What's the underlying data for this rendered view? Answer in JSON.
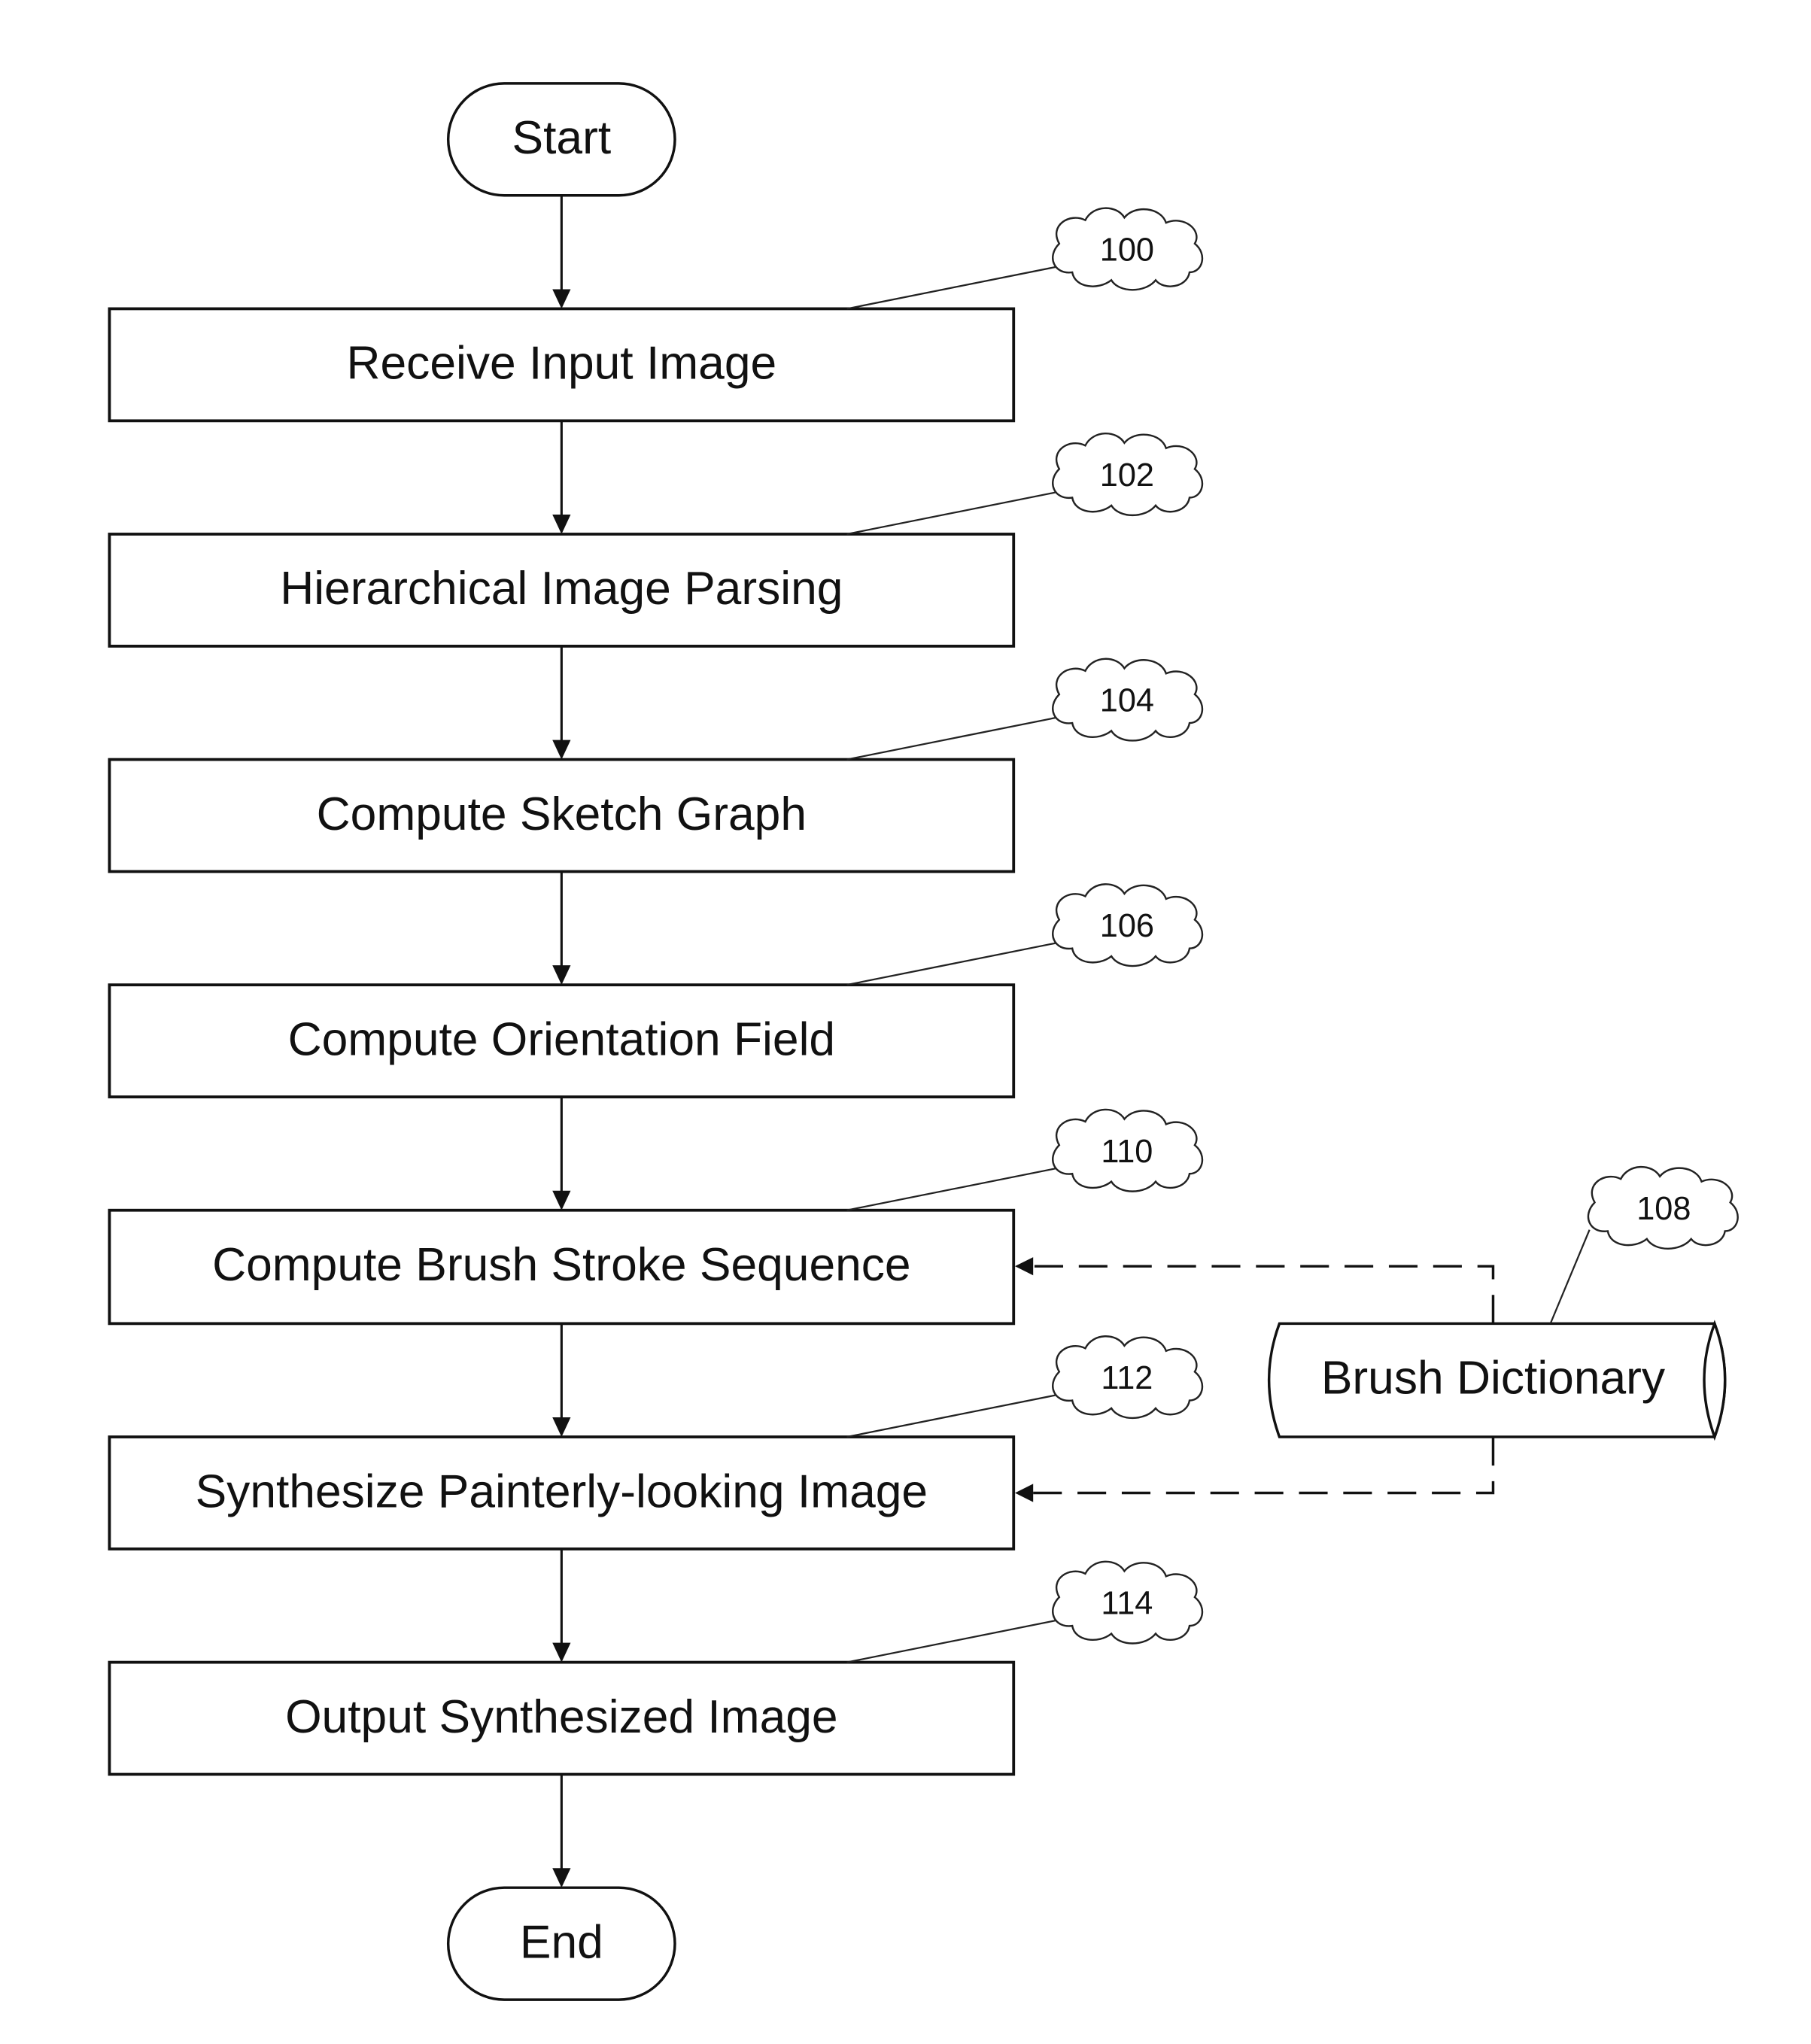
{
  "diagram": {
    "type": "flowchart",
    "terminals": {
      "start": "Start",
      "end": "End"
    },
    "steps": [
      {
        "id": "receive",
        "label": "Receive Input Image",
        "ref": "100"
      },
      {
        "id": "parse",
        "label": "Hierarchical Image Parsing",
        "ref": "102"
      },
      {
        "id": "sketch",
        "label": "Compute Sketch Graph",
        "ref": "104"
      },
      {
        "id": "orientation",
        "label": "Compute Orientation Field",
        "ref": "106"
      },
      {
        "id": "stroke",
        "label": "Compute Brush Stroke Sequence",
        "ref": "110"
      },
      {
        "id": "synthesize",
        "label": "Synthesize Painterly-looking Image",
        "ref": "112"
      },
      {
        "id": "output",
        "label": "Output Synthesized Image",
        "ref": "114"
      }
    ],
    "datastore": {
      "label": "Brush Dictionary",
      "ref": "108"
    },
    "edges": [
      {
        "from": "start",
        "to": "receive",
        "style": "solid"
      },
      {
        "from": "receive",
        "to": "parse",
        "style": "solid"
      },
      {
        "from": "parse",
        "to": "sketch",
        "style": "solid"
      },
      {
        "from": "sketch",
        "to": "orientation",
        "style": "solid"
      },
      {
        "from": "orientation",
        "to": "stroke",
        "style": "solid"
      },
      {
        "from": "stroke",
        "to": "synthesize",
        "style": "solid"
      },
      {
        "from": "synthesize",
        "to": "output",
        "style": "solid"
      },
      {
        "from": "output",
        "to": "end",
        "style": "solid"
      },
      {
        "from": "brush-dictionary",
        "to": "stroke",
        "style": "dashed"
      },
      {
        "from": "brush-dictionary",
        "to": "synthesize",
        "style": "dashed"
      }
    ]
  }
}
